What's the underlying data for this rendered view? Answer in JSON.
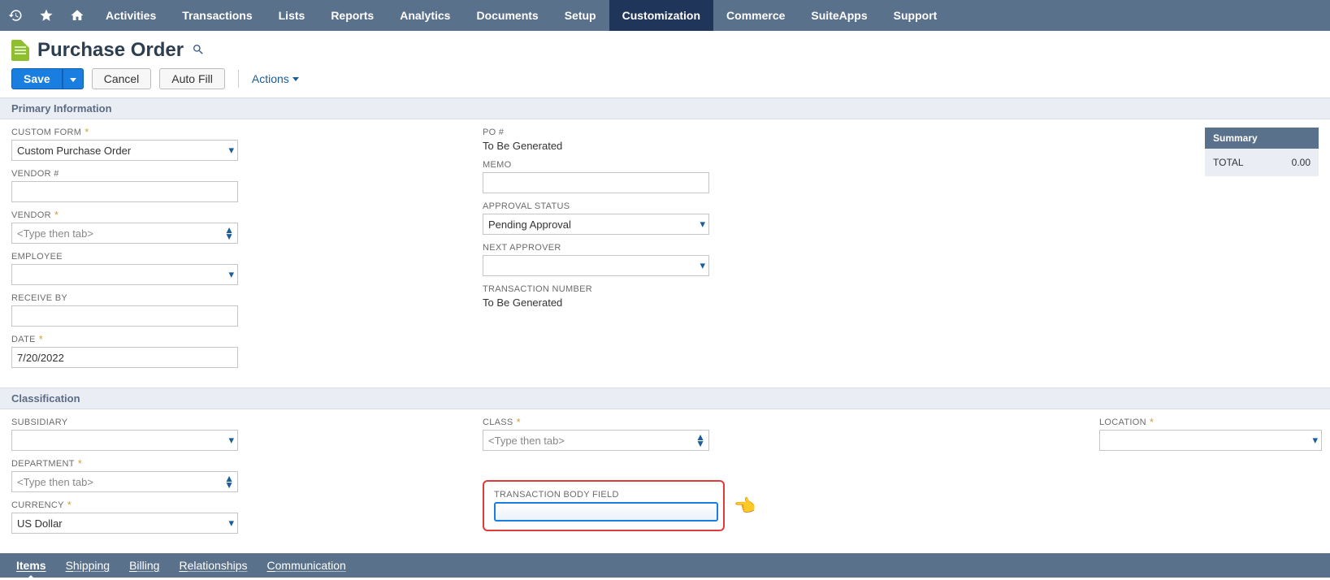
{
  "nav": {
    "items": [
      "Activities",
      "Transactions",
      "Lists",
      "Reports",
      "Analytics",
      "Documents",
      "Setup",
      "Customization",
      "Commerce",
      "SuiteApps",
      "Support"
    ],
    "activeIndex": 7
  },
  "header": {
    "title": "Purchase Order",
    "actions": {
      "save": "Save",
      "cancel": "Cancel",
      "autofill": "Auto Fill",
      "more": "Actions"
    }
  },
  "sections": {
    "primary": {
      "title": "Primary Information",
      "customForm": {
        "label": "CUSTOM FORM",
        "value": "Custom Purchase Order"
      },
      "vendorNum": {
        "label": "VENDOR #",
        "value": ""
      },
      "vendor": {
        "label": "VENDOR",
        "placeholder": "<Type then tab>"
      },
      "employee": {
        "label": "EMPLOYEE",
        "value": ""
      },
      "receiveBy": {
        "label": "RECEIVE BY",
        "value": ""
      },
      "date": {
        "label": "DATE",
        "value": "7/20/2022"
      },
      "poNum": {
        "label": "PO #",
        "value": "To Be Generated"
      },
      "memo": {
        "label": "MEMO",
        "value": ""
      },
      "approval": {
        "label": "APPROVAL STATUS",
        "value": "Pending Approval"
      },
      "nextAppr": {
        "label": "NEXT APPROVER",
        "value": ""
      },
      "tranNum": {
        "label": "TRANSACTION NUMBER",
        "value": "To Be Generated"
      }
    },
    "classification": {
      "title": "Classification",
      "subsidiary": {
        "label": "SUBSIDIARY",
        "value": ""
      },
      "department": {
        "label": "DEPARTMENT",
        "placeholder": "<Type then tab>"
      },
      "currency": {
        "label": "CURRENCY",
        "value": "US Dollar"
      },
      "classF": {
        "label": "CLASS",
        "placeholder": "<Type then tab>"
      },
      "tranBody": {
        "label": "TRANSACTION BODY FIELD",
        "value": ""
      },
      "location": {
        "label": "LOCATION",
        "value": ""
      }
    }
  },
  "summary": {
    "header": "Summary",
    "total_label": "TOTAL",
    "total_value": "0.00"
  },
  "subtabs": {
    "items": [
      "Items",
      "Shipping",
      "Billing",
      "Relationships",
      "Communication"
    ],
    "activeIndex": 0
  }
}
